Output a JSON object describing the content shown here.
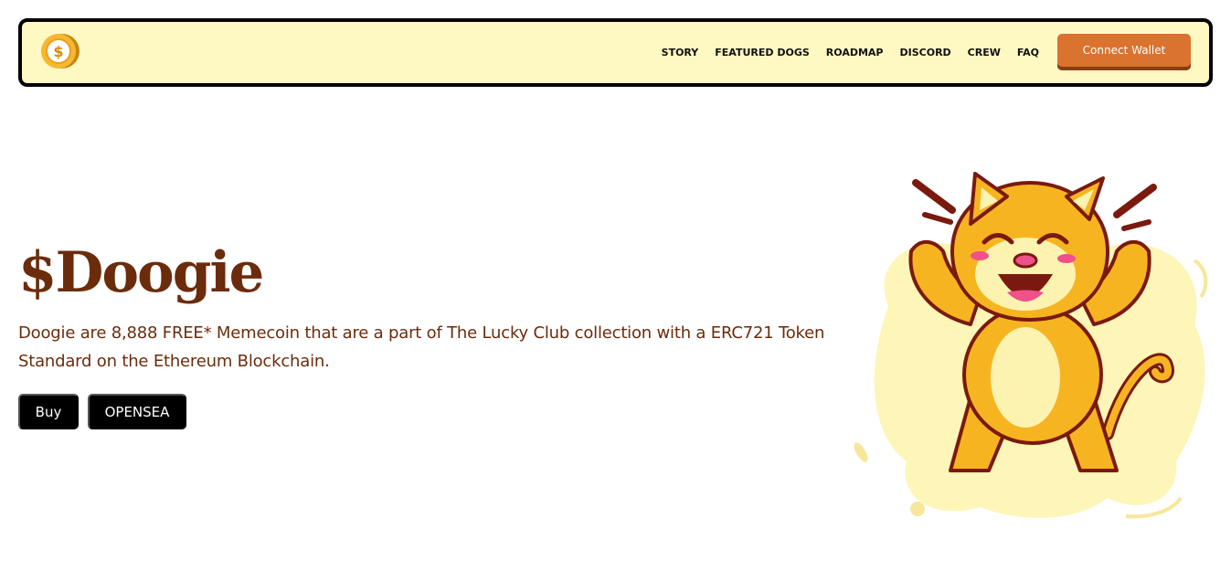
{
  "nav": {
    "links": [
      "STORY",
      "FEATURED DOGS",
      "ROADMAP",
      "DISCORD",
      "CREW",
      "FAQ"
    ],
    "connect_label": "Connect Wallet",
    "logo_icon": "dollar-coin-icon"
  },
  "hero": {
    "title": "$Doogie",
    "description": "Doogie are 8,888 FREE* Memecoin that are a part of The Lucky Club collection with a ERC721 Token Standard on the Ethereum Blockchain.",
    "buy_label": "Buy",
    "opensea_label": "OPENSEA"
  },
  "colors": {
    "navbar_bg": "#fef9c3",
    "accent": "#d9732f",
    "text_brown": "#6b2c0c",
    "button_bg": "#000000"
  }
}
